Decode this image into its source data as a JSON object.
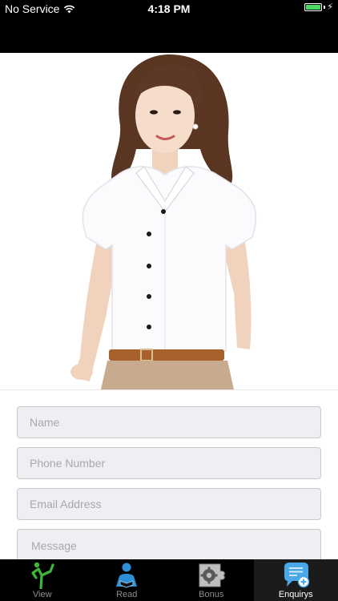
{
  "status_bar": {
    "carrier": "No Service",
    "time": "4:18 PM",
    "battery_level": 1.0
  },
  "form": {
    "name_placeholder": "Name",
    "phone_placeholder": "Phone Number",
    "email_placeholder": "Email Address",
    "message_placeholder": "Message"
  },
  "tabs": [
    {
      "label": "View",
      "icon": "yoga-figure-icon",
      "active": false
    },
    {
      "label": "Read",
      "icon": "person-reading-icon",
      "active": false
    },
    {
      "label": "Bonus",
      "icon": "puzzle-gear-icon",
      "active": false
    },
    {
      "label": "Enquirys",
      "icon": "chat-bubble-plus-icon",
      "active": true
    }
  ],
  "colors": {
    "status_bar_bg": "#000000",
    "tab_bar_bg": "#000000",
    "field_bg": "#eeeff2",
    "battery_green": "#4cd964"
  }
}
